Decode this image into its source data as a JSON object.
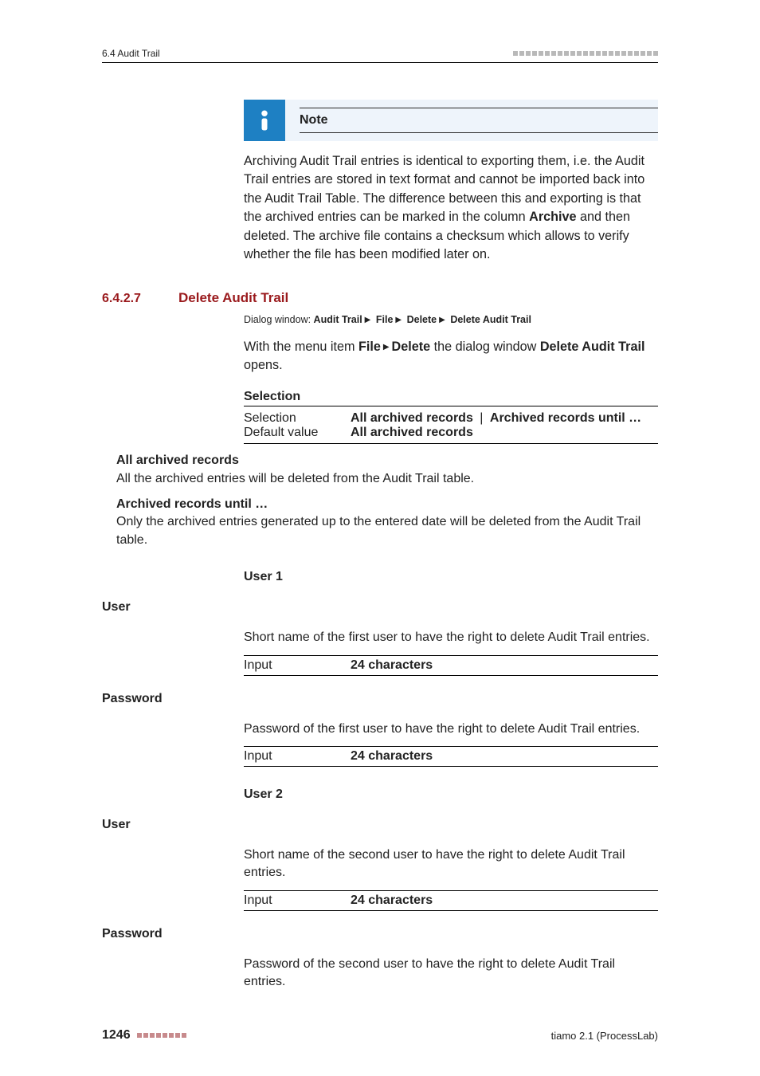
{
  "header": {
    "section_ref": "6.4 Audit Trail"
  },
  "note": {
    "label": "Note",
    "body_parts": [
      "Archiving Audit Trail entries is identical to exporting them, i.e. the Audit Trail entries are stored in text format and cannot be imported back into the Audit Trail Table. The difference between this and exporting is that the archived entries can be marked in the column ",
      "Archive",
      " and then deleted. The archive file contains a checksum which allows to verify whether the file has been modified later on."
    ]
  },
  "section": {
    "number": "6.4.2.7",
    "title": "Delete Audit Trail"
  },
  "dialog_path": {
    "prefix": "Dialog window: ",
    "parts": [
      "Audit Trail",
      "File",
      "Delete",
      "Delete Audit Trail"
    ]
  },
  "intro": {
    "pre": "With the menu item ",
    "menu1": "File",
    "mid": " ▸ ",
    "menu2": "Delete",
    "mid2": " the dialog window ",
    "dlg": "Delete Audit Trail",
    "post": " opens."
  },
  "selection": {
    "heading": "Selection",
    "rows": [
      {
        "key": "Selection",
        "opt1": "All archived records",
        "opt2": "Archived records until …"
      },
      {
        "key": "Default value",
        "val": "All archived records"
      }
    ],
    "defs": [
      {
        "term": "All archived records",
        "desc": "All the archived entries will be deleted from the Audit Trail table."
      },
      {
        "term": "Archived records until …",
        "desc": "Only the archived entries generated up to the entered date will be deleted from the Audit Trail table."
      }
    ]
  },
  "user1": {
    "heading": "User 1",
    "user_label": "User",
    "user_desc": "Short name of the first user to have the right to delete Audit Trail entries.",
    "user_input_key": "Input",
    "user_input_val": "24 characters",
    "pw_label": "Password",
    "pw_desc": "Password of the first user to have the right to delete Audit Trail entries.",
    "pw_input_key": "Input",
    "pw_input_val": "24 characters"
  },
  "user2": {
    "heading": "User 2",
    "user_label": "User",
    "user_desc": "Short name of the second user to have the right to delete Audit Trail entries.",
    "user_input_key": "Input",
    "user_input_val": "24 characters",
    "pw_label": "Password",
    "pw_desc": "Password of the second user to have the right to delete Audit Trail entries."
  },
  "footer": {
    "page": "1246",
    "product": "tiamo 2.1 (ProcessLab)"
  }
}
